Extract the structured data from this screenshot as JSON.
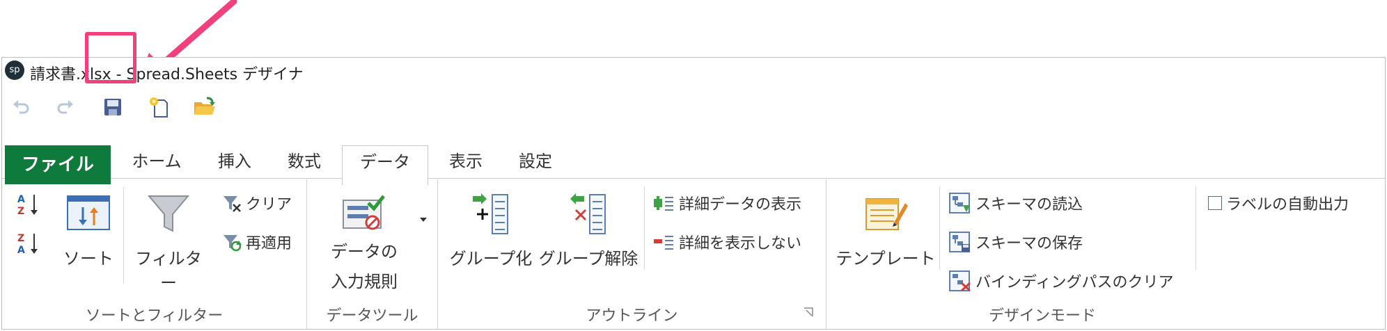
{
  "window": {
    "app_icon": "sp",
    "title": "請求書.xlsx - Spread.Sheets デザイナ"
  },
  "quick_access": {
    "undo_icon": "undo-icon",
    "redo_icon": "redo-icon",
    "save_icon": "save-icon",
    "new_icon": "new-file-icon",
    "open_icon": "open-folder-icon",
    "highlight_color": "#f0407e"
  },
  "tabs": [
    "ファイル",
    "ホーム",
    "挿入",
    "数式",
    "データ",
    "表示",
    "設定"
  ],
  "active_tab": "データ",
  "file_tab_color": "#0e7a3c",
  "ribbon": {
    "sort_filter": {
      "sort_label": "ソート",
      "filter_label": "フィルター",
      "clear_label": "クリア",
      "reapply_label": "再適用",
      "group_label": "ソートとフィルター"
    },
    "data_tools": {
      "validation_label_1": "データの",
      "validation_label_2": "入力規則",
      "group_label": "データツール"
    },
    "outline": {
      "group_label_btn": "グループ化",
      "ungroup_label": "グループ解除",
      "show_detail_label": "詳細データの表示",
      "hide_detail_label": "詳細を表示しない",
      "group_label": "アウトライン"
    },
    "design_mode": {
      "template_label": "テンプレート",
      "load_schema_label": "スキーマの読込",
      "save_schema_label": "スキーマの保存",
      "clear_binding_label": "バインディングパスのクリア",
      "auto_label_label": "ラベルの自動出力",
      "group_label": "デザインモード"
    }
  }
}
